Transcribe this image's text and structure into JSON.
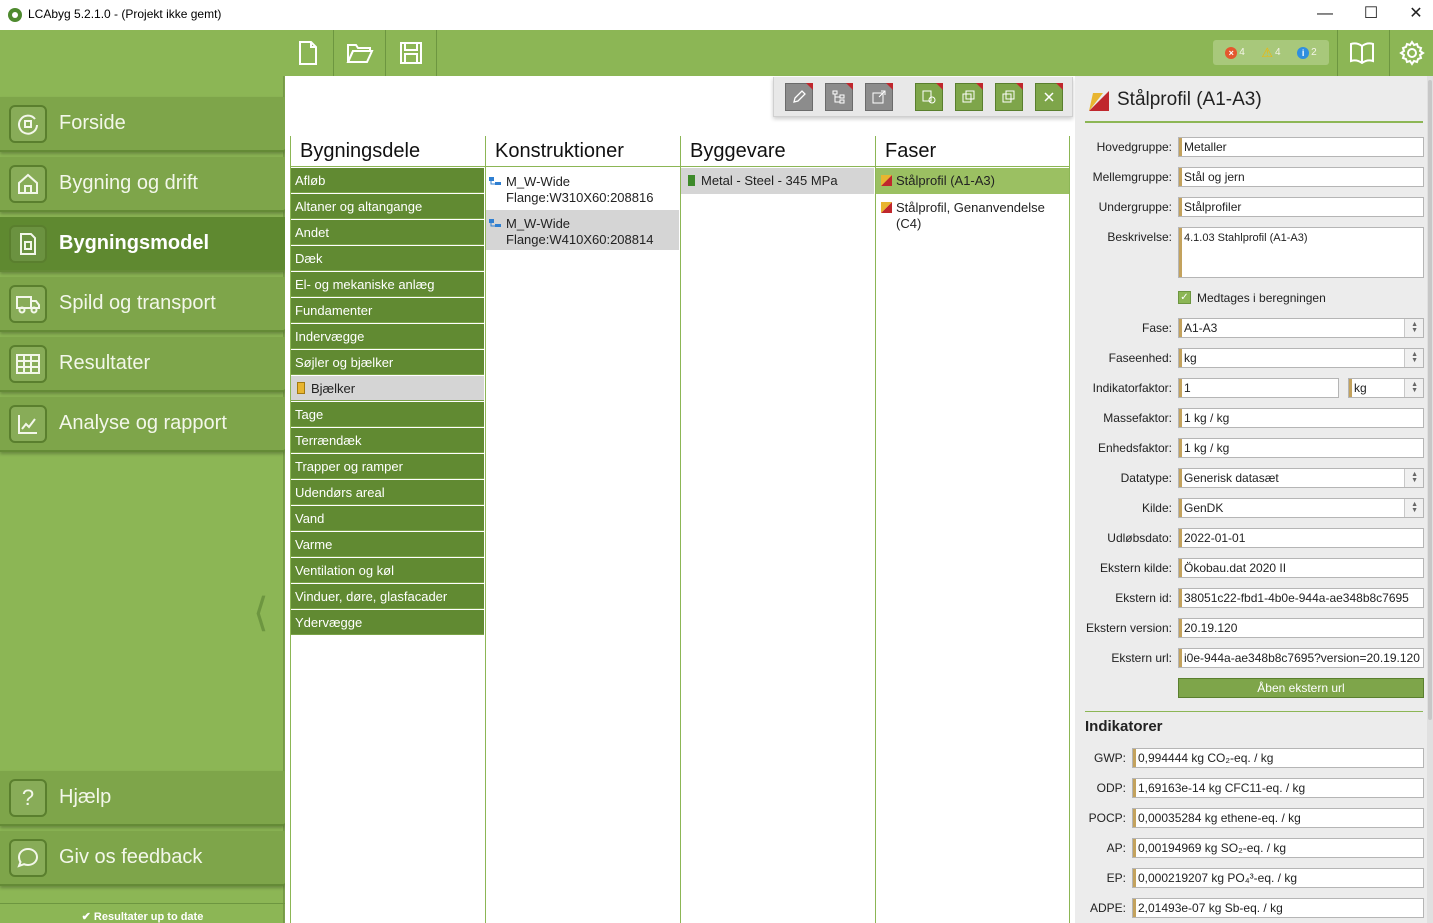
{
  "window": {
    "title": "LCAbyg 5.2.1.0 - (Projekt ikke gemt)"
  },
  "status": {
    "errors": "4",
    "warnings": "4",
    "info": "2"
  },
  "nav": {
    "forside": "Forside",
    "bygning": "Bygning og drift",
    "bygningsmodel": "Bygningsmodel",
    "spild": "Spild og transport",
    "resultater": "Resultater",
    "analyse": "Analyse og rapport",
    "hjaelp": "Hjælp",
    "feedback": "Giv os feedback",
    "status": "✔ Resultater up to date"
  },
  "columns": {
    "bygningsdele": "Bygningsdele",
    "konstruktioner": "Konstruktioner",
    "byggevare": "Byggevare",
    "faser": "Faser"
  },
  "bygningsdele": [
    "Afløb",
    "Altaner og altangange",
    "Andet",
    "Dæk",
    "El- og mekaniske anlæg",
    "Fundamenter",
    "Indervægge",
    "Søjler og bjælker",
    "Bjælker",
    "Tage",
    "Terrændæk",
    "Trapper og ramper",
    "Udendørs areal",
    "Vand",
    "Varme",
    "Ventilation og køl",
    "Vinduer, døre, glasfacader",
    "Ydervægge"
  ],
  "konstruktioner": [
    {
      "line1": "M_W-Wide",
      "line2": "Flange:W310X60:208816"
    },
    {
      "line1": "M_W-Wide",
      "line2": "Flange:W410X60:208814"
    }
  ],
  "byggevare": [
    "Metal - Steel - 345 MPa"
  ],
  "faser": [
    {
      "line1": "Stålprofil (A1-A3)",
      "line2": ""
    },
    {
      "line1": "Stålprofil, Genanvendelse",
      "line2": "(C4)"
    }
  ],
  "detail": {
    "title": "Stålprofil (A1-A3)",
    "hovedgruppe_label": "Hovedgruppe:",
    "hovedgruppe": "Metaller",
    "mellemgruppe_label": "Mellemgruppe:",
    "mellemgruppe": "Stål og jern",
    "undergruppe_label": "Undergruppe:",
    "undergruppe": "Stålprofiler",
    "beskrivelse_label": "Beskrivelse:",
    "beskrivelse": "4.1.03 Stahlprofil (A1-A3)",
    "medtages": "Medtages i beregningen",
    "fase_label": "Fase:",
    "fase": "A1-A3",
    "faseenhed_label": "Faseenhed:",
    "faseenhed": "kg",
    "indikatorfaktor_label": "Indikatorfaktor:",
    "indikatorfaktor": "1",
    "indikatorfaktor_unit": "kg",
    "massefaktor_label": "Massefaktor:",
    "massefaktor": "1 kg / kg",
    "enhedsfaktor_label": "Enhedsfaktor:",
    "enhedsfaktor": "1 kg / kg",
    "datatype_label": "Datatype:",
    "datatype": "Generisk datasæt",
    "kilde_label": "Kilde:",
    "kilde": "GenDK",
    "udlobsdato_label": "Udløbsdato:",
    "udlobsdato": "2022-01-01",
    "ekstern_kilde_label": "Ekstern kilde:",
    "ekstern_kilde": "Ökobau.dat 2020 II",
    "ekstern_id_label": "Ekstern id:",
    "ekstern_id": "38051c22-fbd1-4b0e-944a-ae348b8c7695",
    "ekstern_version_label": "Ekstern version:",
    "ekstern_version": "20.19.120",
    "ekstern_url_label": "Ekstern url:",
    "ekstern_url": "i0e-944a-ae348b8c7695?version=20.19.120",
    "open_url": "Åben ekstern url"
  },
  "indikatorer": {
    "heading": "Indikatorer",
    "rows": [
      {
        "label": "GWP:",
        "value": "0,994444 kg CO₂-eq. / kg"
      },
      {
        "label": "ODP:",
        "value": "1,69163e-14 kg CFC11-eq. / kg"
      },
      {
        "label": "POCP:",
        "value": "0,00035284 kg ethene-eq. / kg"
      },
      {
        "label": "AP:",
        "value": "0,00194969 kg SO₂-eq. / kg"
      },
      {
        "label": "EP:",
        "value": "0,000219207 kg PO₄³-eq. / kg"
      },
      {
        "label": "ADPE:",
        "value": "2,01493e-07 kg Sb-eq. / kg"
      }
    ]
  }
}
